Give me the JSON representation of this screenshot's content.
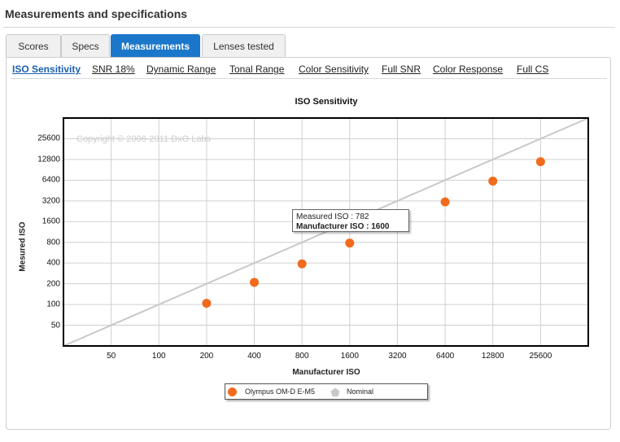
{
  "section_title": "Measurements and specifications",
  "tabs": [
    {
      "label": "Scores",
      "active": false
    },
    {
      "label": "Specs",
      "active": false
    },
    {
      "label": "Measurements",
      "active": true
    },
    {
      "label": "Lenses tested",
      "active": false
    }
  ],
  "subnav": [
    {
      "label": "ISO Sensitivity",
      "active": true
    },
    {
      "label": "SNR 18%",
      "active": false
    },
    {
      "label": "Dynamic Range",
      "active": false
    },
    {
      "label": "Tonal Range",
      "active": false
    },
    {
      "label": "Color Sensitivity",
      "active": false
    },
    {
      "label": "Full SNR",
      "active": false
    },
    {
      "label": "Color Response",
      "active": false
    },
    {
      "label": "Full CS",
      "active": false
    }
  ],
  "watermark": "Copyright © 2008-2011 DxO Labs",
  "tooltip": {
    "line1": "Measured ISO : 782",
    "line2": "Manufacturer ISO : 1600"
  },
  "chart_data": {
    "type": "scatter",
    "title": "ISO Sensitivity",
    "xlabel": "Manufacturer ISO",
    "ylabel": "Mesured ISO",
    "x_scale": "log2",
    "y_scale": "log2",
    "x_ticks": [
      "50",
      "100",
      "200",
      "400",
      "800",
      "1600",
      "3200",
      "6400",
      "12800",
      "25600"
    ],
    "y_ticks": [
      "50",
      "100",
      "200",
      "400",
      "800",
      "1600",
      "3200",
      "6400",
      "12800",
      "25600"
    ],
    "xlim": [
      25,
      51200
    ],
    "ylim": [
      25,
      51200
    ],
    "grid": true,
    "legend_position": "bottom",
    "series": [
      {
        "name": "Olympus OM-D E-M5",
        "color": "#f26b1d",
        "points": [
          {
            "x": 200,
            "y": 104
          },
          {
            "x": 400,
            "y": 210
          },
          {
            "x": 800,
            "y": 390
          },
          {
            "x": 1600,
            "y": 782
          },
          {
            "x": 6400,
            "y": 3100
          },
          {
            "x": 12800,
            "y": 6200
          },
          {
            "x": 25600,
            "y": 11900
          }
        ]
      },
      {
        "name": "Nominal",
        "color": "#c8c8c8",
        "line": [
          {
            "x": 25,
            "y": 25
          },
          {
            "x": 51200,
            "y": 51200
          }
        ]
      }
    ]
  }
}
